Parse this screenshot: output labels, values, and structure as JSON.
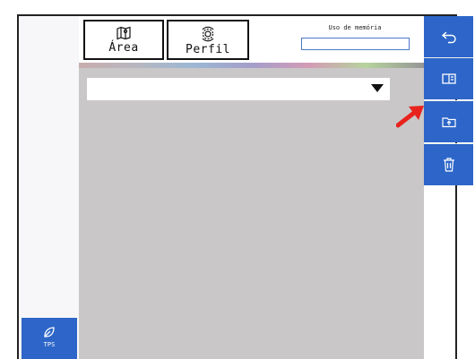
{
  "tabs": {
    "area": {
      "label": "Área",
      "icon": "map-icon"
    },
    "perfil": {
      "label": "Perfil",
      "icon": "gear-refresh-icon"
    }
  },
  "memory": {
    "label": "Uso de memória",
    "value": ""
  },
  "dropdown": {
    "selected": ""
  },
  "sidebar": [
    {
      "icon": "back-icon"
    },
    {
      "icon": "columns-icon"
    },
    {
      "icon": "folder-export-icon"
    },
    {
      "icon": "trash-icon"
    }
  ],
  "bottom_left": {
    "label": "TPS",
    "icon": "leaf-icon"
  },
  "colors": {
    "accent": "#2d66c8",
    "panel": "#c9c7c8",
    "annotation": "#e8231d"
  }
}
